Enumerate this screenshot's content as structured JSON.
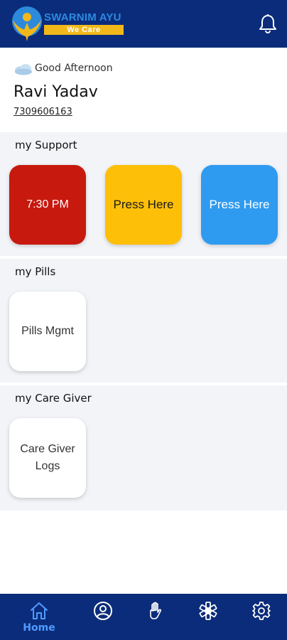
{
  "app": {
    "brand": "SWARNIM AYU",
    "tagline": "We Care"
  },
  "greeting": {
    "text": "Good Afternoon",
    "name": "Ravi Yadav",
    "phone": "7309606163"
  },
  "sections": {
    "support": {
      "title": "my Support",
      "tiles": [
        "7:30 PM",
        "Press Here",
        "Press Here"
      ]
    },
    "pills": {
      "title": "my Pills",
      "tiles": [
        "Pills Mgmt"
      ]
    },
    "caregiver": {
      "title": "my Care Giver",
      "tiles": [
        "Care Giver Logs"
      ]
    }
  },
  "bottom_nav": {
    "items": [
      {
        "label": "Home",
        "icon": "home-icon",
        "active": true
      },
      {
        "label": "",
        "icon": "profile-icon"
      },
      {
        "label": "",
        "icon": "hand-icon"
      },
      {
        "label": "",
        "icon": "star-of-life-icon"
      },
      {
        "label": "",
        "icon": "settings-gear-icon"
      }
    ]
  },
  "colors": {
    "header_bg": "#0b2c7a",
    "tile_red": "#c8190f",
    "tile_yellow": "#fdbf08",
    "tile_blue": "#2f9bf0",
    "nav_active": "#4f9bff",
    "section_bg": "#f3f4f8"
  },
  "icons": {
    "logo": "swarnim-ayu-logo-icon",
    "bell": "bell-icon",
    "weather": "cloud-icon"
  }
}
